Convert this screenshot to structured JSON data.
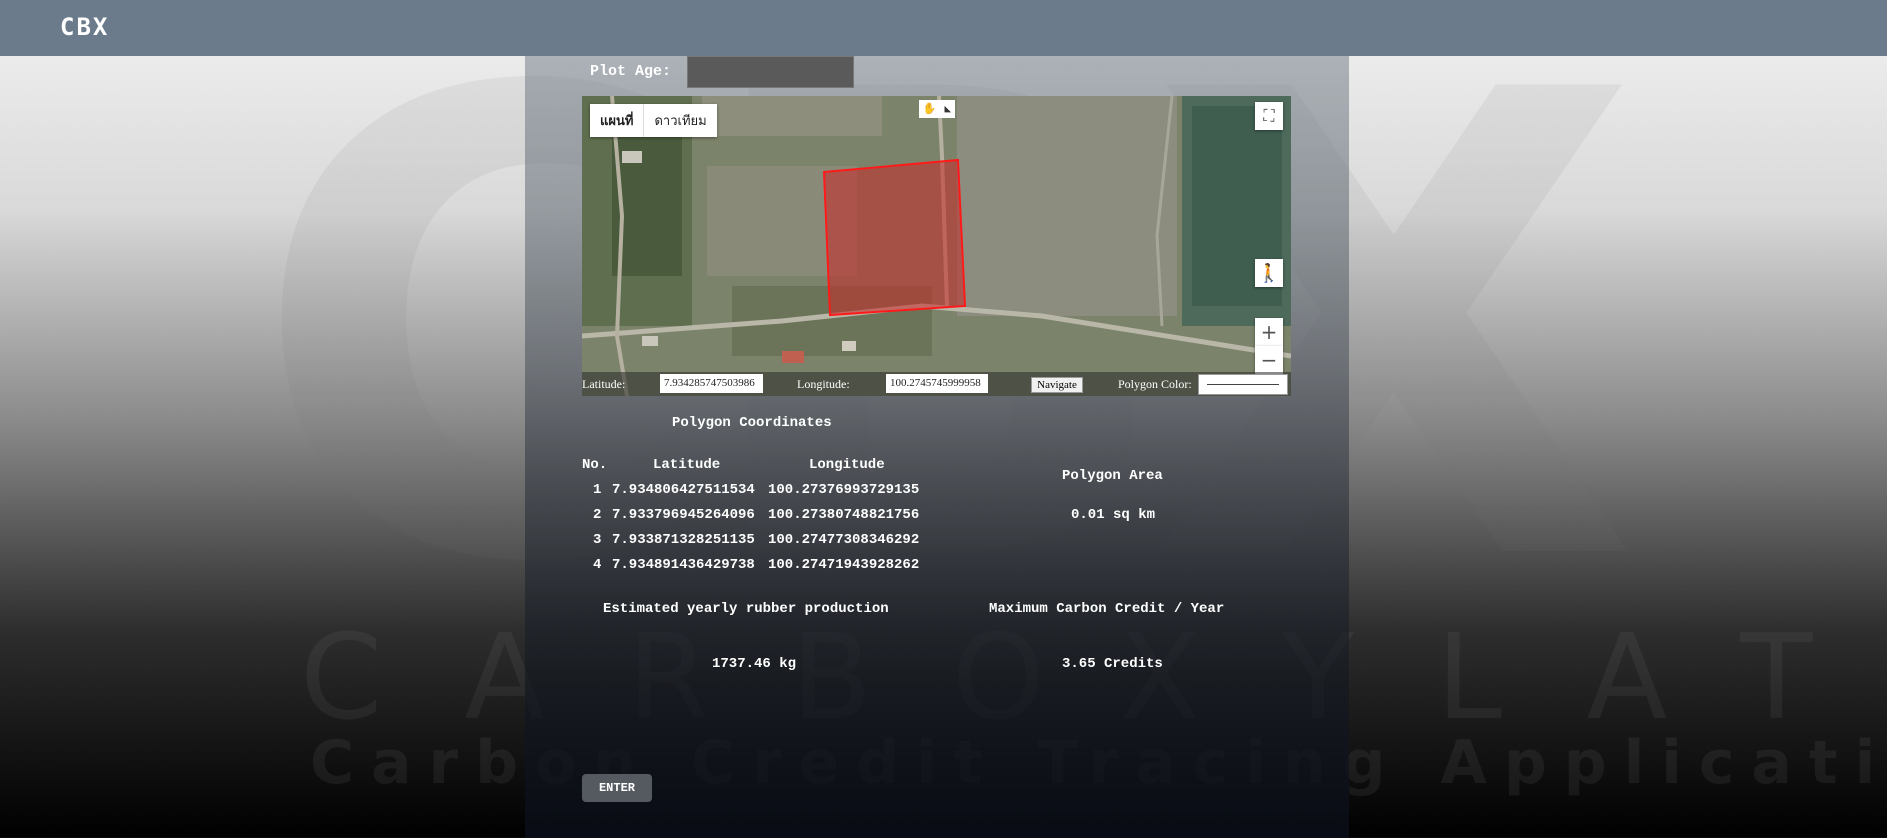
{
  "app": {
    "logo_text": "CBX"
  },
  "background": {
    "watermark_big": "CBX",
    "watermark_mid": "CARBOXYLATION",
    "watermark_small": "Carbon Credit Tracing Application"
  },
  "form": {
    "plot_age_label": "Plot Age:",
    "plot_age_value": ""
  },
  "map": {
    "map_type_map": "แผนที่",
    "map_type_satellite": "ดาวเทียม",
    "fullscreen_icon": "⛶",
    "pegman_icon": "🚶",
    "zoom_in_label": "+",
    "zoom_out_label": "−",
    "polygon_color": "#e02020",
    "latitude_label": "Latitude:",
    "latitude_value": "7.934285747503986",
    "longitude_label": "Longitude:",
    "longitude_value": "100.2745745999958",
    "navigate_label": "Navigate",
    "polygon_color_label": "Polygon Color:"
  },
  "coordinates": {
    "title": "Polygon Coordinates",
    "headers": {
      "no": "No.",
      "lat": "Latitude",
      "lng": "Longitude"
    },
    "rows": [
      {
        "no": "1",
        "lat": "7.934806427511534",
        "lng": "100.27376993729135"
      },
      {
        "no": "2",
        "lat": "7.933796945264096",
        "lng": "100.27380748821756"
      },
      {
        "no": "3",
        "lat": "7.933871328251135",
        "lng": "100.27477308346292"
      },
      {
        "no": "4",
        "lat": "7.934891436429738",
        "lng": "100.27471943928262"
      }
    ]
  },
  "area": {
    "title": "Polygon Area",
    "value": "0.01 sq km"
  },
  "production": {
    "title": "Estimated yearly rubber production",
    "value": "1737.46 kg"
  },
  "carbon": {
    "title": "Maximum Carbon Credit / Year",
    "value": "3.65 Credits"
  },
  "actions": {
    "enter_label": "ENTER"
  }
}
